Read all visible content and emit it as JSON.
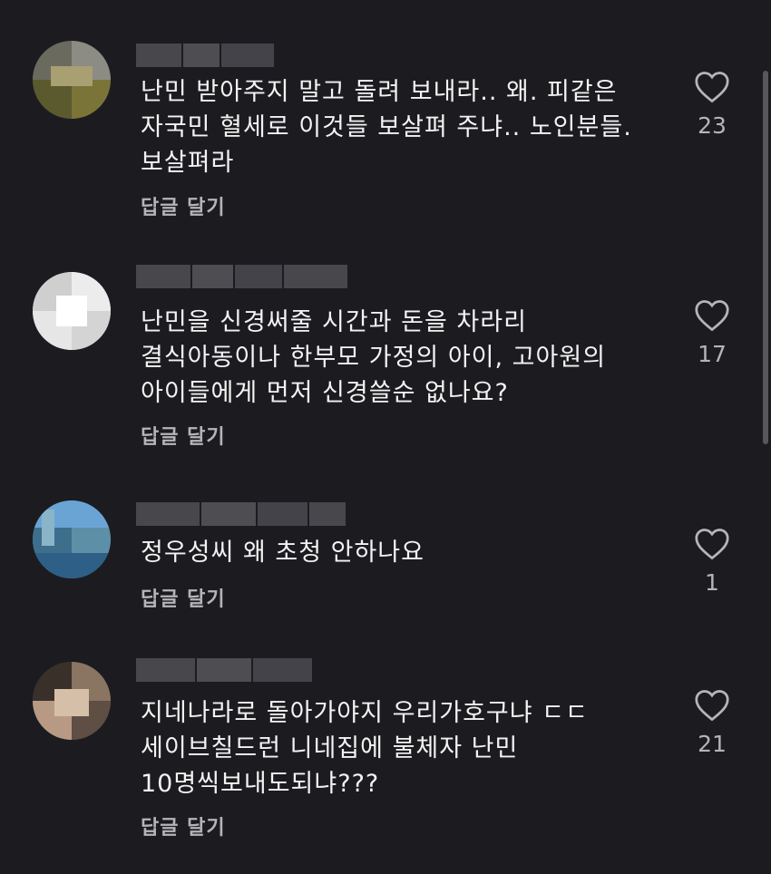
{
  "comments": [
    {
      "text": "난민 받아주지 말고 돌려 보내라.. 왜. 피같은\n자국민 혈세로 이것들 보살펴 주냐.. 노인분들.\n보살펴라",
      "reply_label": "답글 달기",
      "like_count": "23",
      "like_icon": "heart-outline-icon"
    },
    {
      "text": "난민을 신경써줄 시간과 돈을 차라리\n결식아동이나 한부모 가정의 아이, 고아원의\n아이들에게 먼저 신경쓸순 없나요?",
      "reply_label": "답글 달기",
      "like_count": "17",
      "like_icon": "heart-outline-icon"
    },
    {
      "text": "정우성씨 왜 초청 안하나요",
      "reply_label": "답글 달기",
      "like_count": "1",
      "like_icon": "heart-outline-icon"
    },
    {
      "text": "지네나라로 돌아가야지 우리가호구냐 ㄷㄷ\n세이브칠드런 니네집에 불체자 난민\n10명씩보내도되냐???",
      "reply_label": "답글 달기",
      "like_count": "21",
      "like_icon": "heart-outline-icon"
    }
  ]
}
